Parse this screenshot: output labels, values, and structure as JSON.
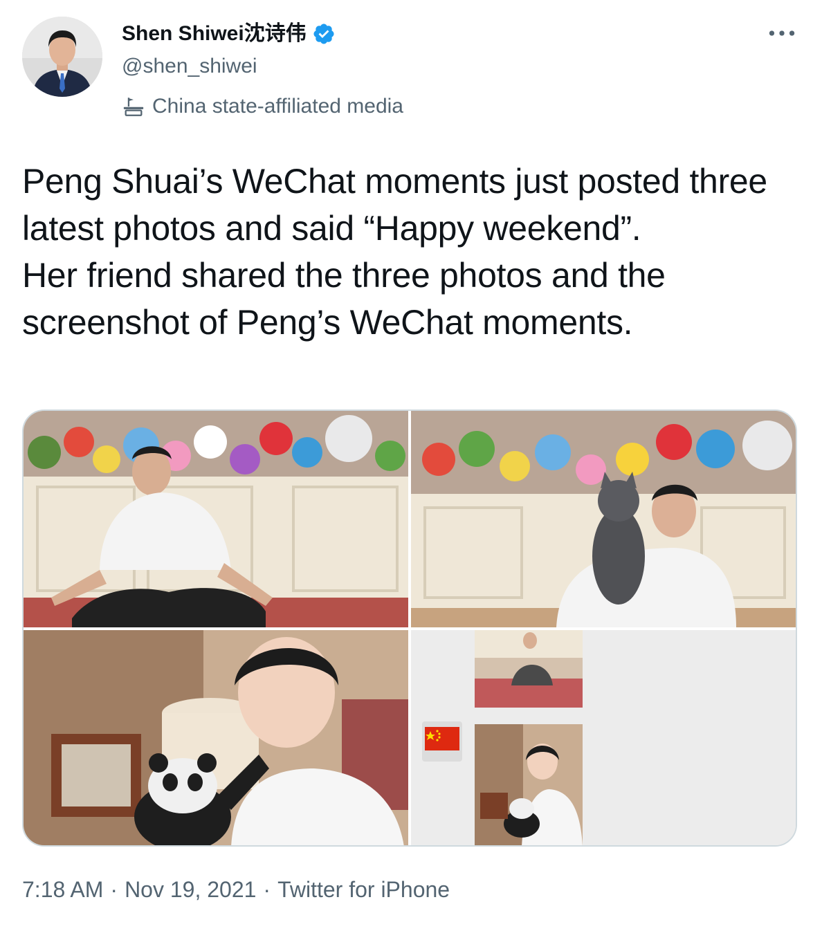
{
  "author": {
    "display_name": "Shen Shiwei沈诗伟",
    "handle": "@shen_shiwei",
    "verified": true,
    "label": "China state-affiliated media",
    "avatar_icon": "person-avatar-icon"
  },
  "tweet": {
    "paragraphs": [
      "Peng Shuai’s WeChat moments just posted three latest photos and said “Happy weekend”.",
      "Her friend shared the three photos and the screenshot of Peng’s WeChat moments."
    ]
  },
  "media": {
    "count": 4,
    "items": [
      {
        "icon": "photo-seated-with-plush-toys"
      },
      {
        "icon": "photo-holding-cat"
      },
      {
        "icon": "photo-selfie-with-panda"
      },
      {
        "icon": "wechat-moments-screenshot",
        "emoji": "🇨🇳"
      }
    ]
  },
  "meta": {
    "time": "7:18 AM",
    "separator": "·",
    "date": "Nov 19, 2021",
    "source": "Twitter for iPhone"
  },
  "colors": {
    "text": "#0f1419",
    "secondary": "#536471",
    "verified_blue": "#1d9bf0",
    "border": "#cfd9de"
  }
}
